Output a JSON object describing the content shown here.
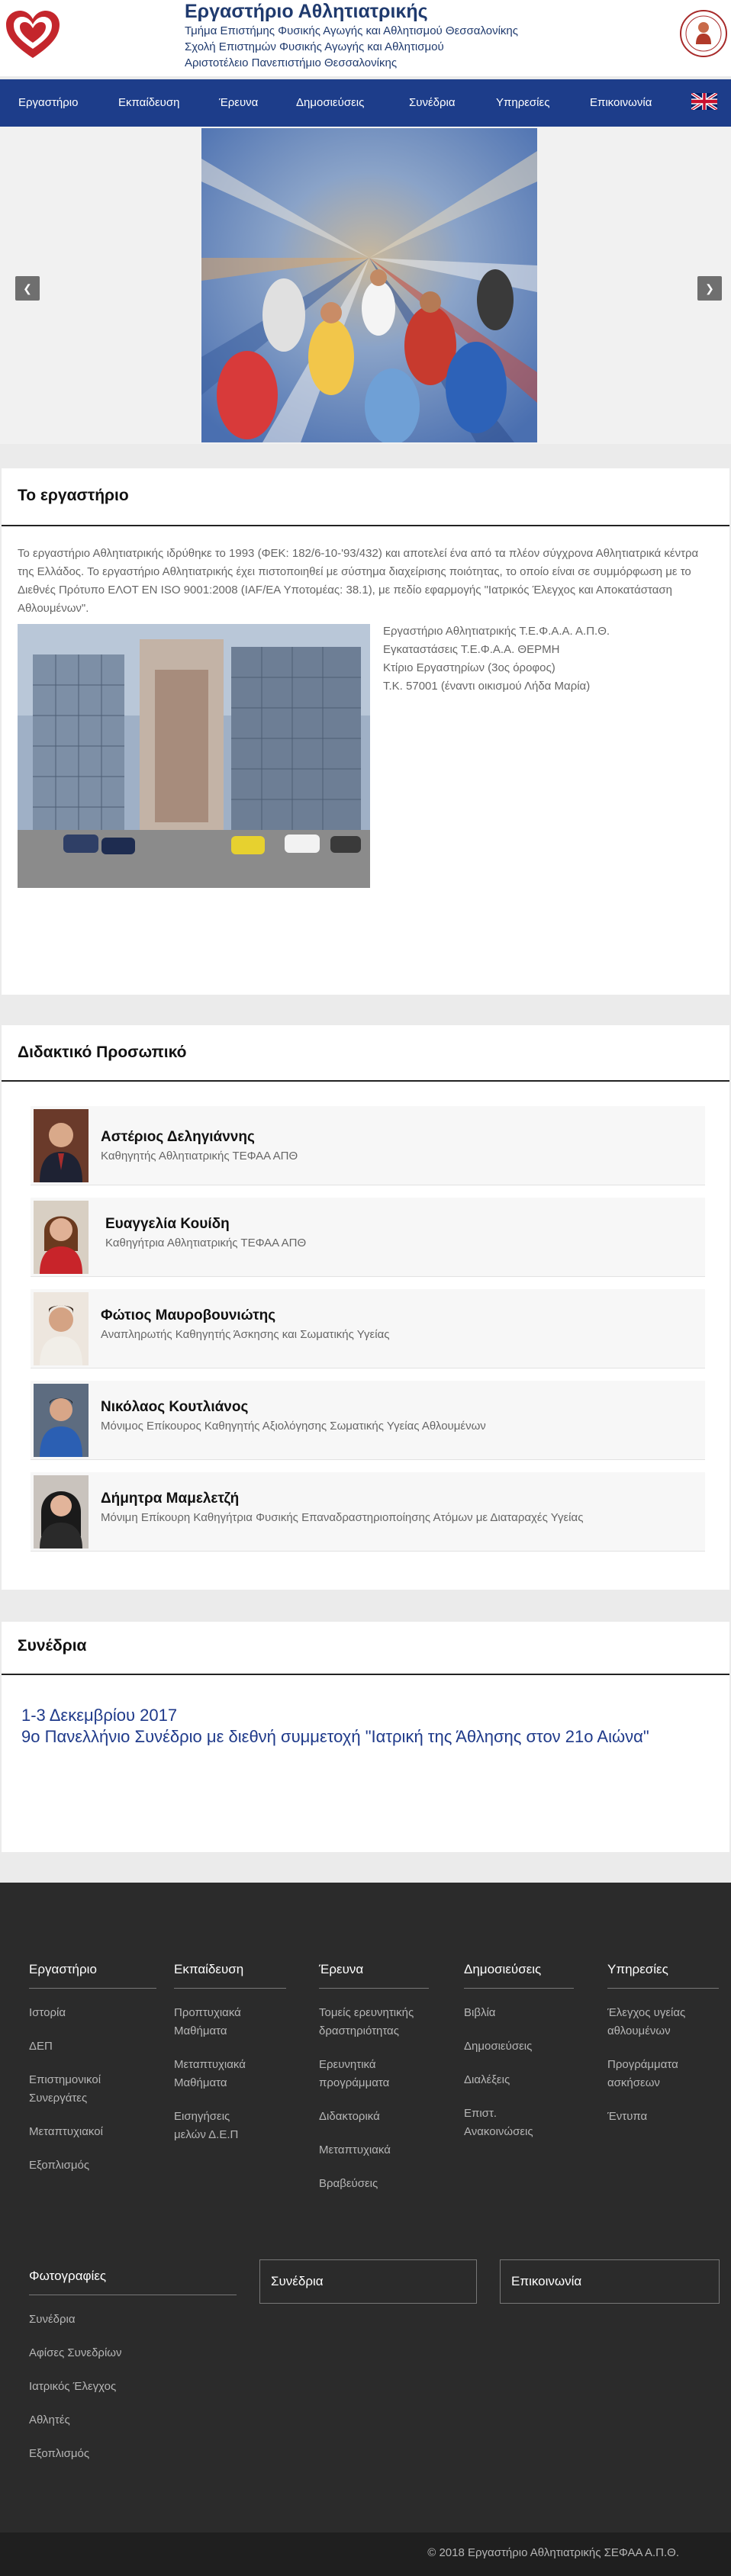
{
  "header": {
    "title": "Εργαστήριο Αθλητιατρικής",
    "lines": [
      "Τμήμα Επιστήμης Φυσικής Αγωγής και Αθλητισμού Θεσσαλονίκης",
      "Σχολή Επιστημών Φυσικής Αγωγής και Αθλητισμού",
      "Αριστοτέλειο Πανεπιστήμιο Θεσσαλονίκης"
    ],
    "left_logo_icon": "heart-logo-icon",
    "right_logo_icon": "university-seal-icon"
  },
  "nav": {
    "items": [
      "Εργαστήριο",
      "Εκπαίδευση",
      "Έρευνα",
      "Δημοσιεύσεις",
      "Συνέδρια",
      "Υπηρεσίες",
      "Επικοινωνία"
    ],
    "flag_icon": "uk-flag-icon"
  },
  "slider": {
    "prev_icon": "chevron-left-icon",
    "next_icon": "chevron-right-icon"
  },
  "lab": {
    "title": "Το εργαστήριο",
    "intro": "Το εργαστήριο Αθλητιατρικής ιδρύθηκε το 1993 (ΦΕΚ: 182/6-10-'93/432) και αποτελεί ένα από τα πλέον σύγχρονα Αθλητιατρικά κέντρα της Ελλάδος. Το εργαστήριο Αθλητιατρικής έχει πιστοποιηθεί με σύστημα διαχείρισης ποιότητας, το οποίο είναι σε συμμόρφωση με το Διεθνές Πρότυπο ΕΛΟΤ EN ISO 9001:2008 (IAF/EA Υποτομέας: 38.1), με πεδίο εφαρμογής \"Ιατρικός Έλεγχος και Αποκατάσταση Αθλουμένων\".",
    "address": [
      "Εργαστήριο Αθλητιατρικής Τ.Ε.Φ.Α.Α. Α.Π.Θ.",
      "Εγκαταστάσεις Τ.Ε.Φ.Α.Α. ΘΕΡΜΗ",
      "Κτίριο Εργαστηρίων (3ος όροφος)",
      "Τ.Κ. 57001 (έναντι οικισμού Λήδα Μαρία)"
    ]
  },
  "staff": {
    "title": "Διδακτικό Προσωπικό",
    "people": [
      {
        "name": "Αστέριος Δεληγιάννης",
        "role": "Καθηγητής Αθλητιατρικής ΤΕΦΑΑ ΑΠΘ"
      },
      {
        "name": "Ευαγγελία Κουίδη",
        "role": "Καθηγήτρια Αθλητιατρικής ΤΕΦΑΑ ΑΠΘ"
      },
      {
        "name": "Φώτιος Μαυροβουνιώτης",
        "role": "Αναπληρωτής Καθηγητής Άσκησης και Σωματικής Υγείας"
      },
      {
        "name": "Νικόλαος Κουτλιάνος",
        "role": "Μόνιμος Επίκουρος Καθηγητής Αξιολόγησης Σωματικής Υγείας Αθλουμένων"
      },
      {
        "name": "Δήμητρα Μαμελετζή",
        "role": "Μόνιμη Επίκουρη Καθηγήτρια Φυσικής Επαναδραστηριοποίησης Ατόμων με Διαταραχές Υγείας"
      }
    ]
  },
  "conferences": {
    "title": "Συνέδρια",
    "date": "1-3 Δεκεμβρίου 2017",
    "event": "9ο Πανελλήνιο Συνέδριο με διεθνή συμμετοχή \"Ιατρική της Άθλησης στον 21ο Αιώνα\""
  },
  "footer": {
    "columns": [
      {
        "heading": "Εργαστήριο",
        "links": [
          "Ιστορία",
          "ΔΕΠ",
          "Επιστημονικοί Συνεργάτες",
          "Μεταπτυχιακοί",
          "Εξοπλισμός"
        ]
      },
      {
        "heading": "Εκπαίδευση",
        "links": [
          "Προπτυχιακά Μαθήματα",
          "Μεταπτυχιακά Μαθήματα",
          "Εισηγήσεις μελών Δ.Ε.Π"
        ]
      },
      {
        "heading": "Έρευνα",
        "links": [
          "Τομείς ερευνητικής δραστηριότητας",
          "Ερευνητικά προγράμματα",
          "Διδακτορικά",
          "Μεταπτυχιακά",
          "Βραβεύσεις"
        ]
      },
      {
        "heading": "Δημοσιεύσεις",
        "links": [
          "Βιβλία",
          "Δημοσιεύσεις",
          "Διαλέξεις",
          "Επιστ. Ανακοινώσεις"
        ]
      },
      {
        "heading": "Υπηρεσίες",
        "links": [
          "Έλεγχος υγείας αθλουμένων",
          "Προγράμματα ασκήσεων",
          "Έντυπα"
        ]
      }
    ],
    "photos": {
      "heading": "Φωτογραφίες",
      "links": [
        "Συνέδρια",
        "Αφίσες Συνεδρίων",
        "Ιατρικός Έλεγχος",
        "Αθλητές",
        "Εξοπλισμός"
      ]
    },
    "boxes": [
      "Συνέδρια",
      "Επικοινωνία"
    ],
    "copyright": "© 2018 Εργαστήριο Αθλητιατρικής ΣΕΦΑΑ Α.Π.Θ."
  }
}
